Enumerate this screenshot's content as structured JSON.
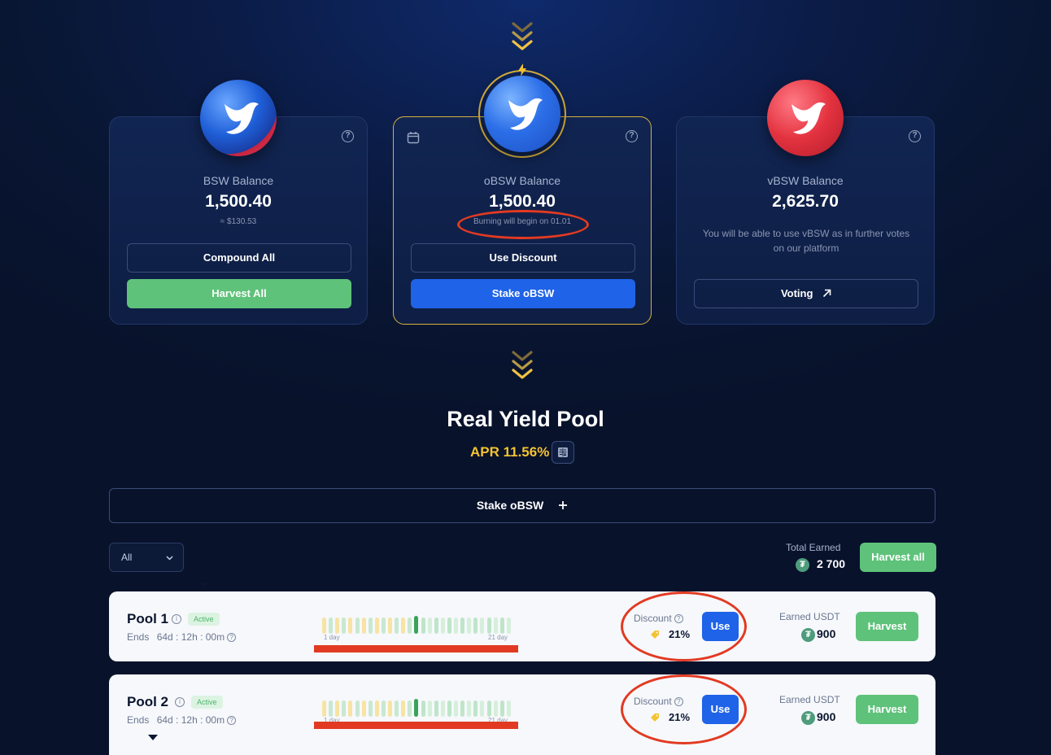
{
  "cards": [
    {
      "label": "BSW Balance",
      "value": "1,500.40",
      "sub": "≈ $130.53",
      "btn1": "Compound All",
      "btn2": "Harvest All"
    },
    {
      "label": "oBSW Balance",
      "value": "1,500.40",
      "sub": "Burning will begin on 01.01",
      "btn1": "Use Discount",
      "btn2": "Stake oBSW"
    },
    {
      "label": "vBSW Balance",
      "value": "2,625.70",
      "sub": "You will be able to use vBSW as in further votes on our platform",
      "btn1": "Voting"
    }
  ],
  "icons": {
    "help": "question-circle-icon",
    "calendar": "calendar-icon",
    "bolt": "lightning-icon",
    "arrow": "arrow-up-right-icon",
    "calc": "calculator-icon",
    "plus": "plus-icon",
    "chevron": "chevron-down-icon",
    "tag": "discount-tag-icon",
    "usdt": "tether-icon"
  },
  "pool": {
    "title": "Real Yield Pool",
    "apr": "APR 11.56%",
    "stake_label": "Stake oBSW",
    "filter": "All",
    "total_earned_label": "Total Earned",
    "total_earned": "2 700",
    "harvest_all": "Harvest all"
  },
  "pools": [
    {
      "name": "Pool 1",
      "status": "Active",
      "ends_label": "Ends",
      "ends": "64d : 12h : 00m",
      "bar_min": "1 day",
      "bar_max": "21 day",
      "discount_label": "Discount",
      "discount": "21%",
      "use": "Use",
      "earned_label": "Earned USDT",
      "earned": "900",
      "harvest": "Harvest"
    },
    {
      "name": "Pool 2",
      "status": "Active",
      "ends_label": "Ends",
      "ends": "64d : 12h : 00m",
      "bar_min": "1 day",
      "bar_max": "21 day",
      "discount_label": "Discount",
      "discount": "21%",
      "use": "Use",
      "earned_label": "Earned USDT",
      "earned": "900",
      "harvest": "Harvest"
    }
  ],
  "colors": {
    "accent_blue": "#1f63e8",
    "accent_green": "#5ec27a",
    "gold": "#f4c331",
    "annotation_red": "#e23a22"
  }
}
